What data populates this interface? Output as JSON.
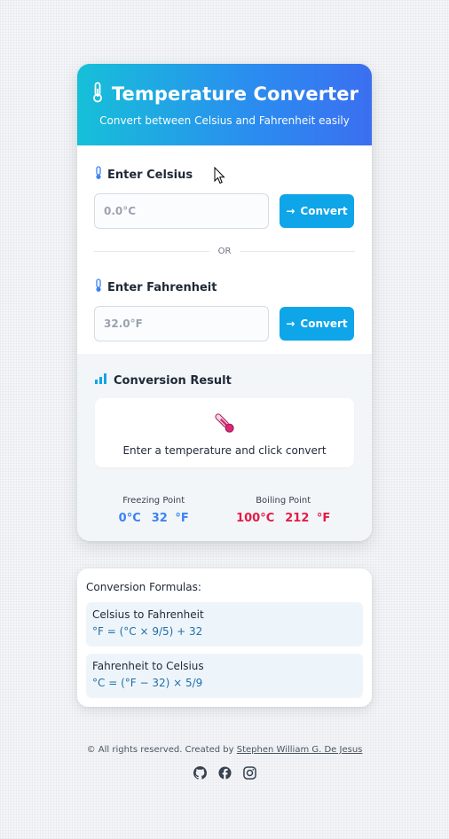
{
  "header": {
    "title": "Temperature Converter",
    "subtitle": "Convert between Celsius and Fahrenheit easily"
  },
  "celsius": {
    "label": "Enter Celsius",
    "placeholder": "0.0°C",
    "button_label": "Convert",
    "button_arrow": "→"
  },
  "divider": {
    "text": "OR"
  },
  "fahrenheit": {
    "label": "Enter Fahrenheit",
    "placeholder": "32.0°F",
    "button_label": "Convert",
    "button_arrow": "→"
  },
  "result": {
    "title": "Conversion Result",
    "message": "Enter a temperature and click convert"
  },
  "reference_points": [
    {
      "label": "Freezing Point",
      "celsius": "0°C",
      "fahrenheit": "32 °F"
    },
    {
      "label": "Boiling Point",
      "celsius": "100°C",
      "fahrenheit": "212 °F"
    }
  ],
  "formulas": {
    "title": "Conversion Formulas:",
    "items": [
      {
        "name": "Celsius to Fahrenheit",
        "equation": "°F = (°C × 9/5) + 32"
      },
      {
        "name": "Fahrenheit to Celsius",
        "equation": "°C = (°F − 32) × 5/9"
      }
    ]
  },
  "footer": {
    "text": "© All rights reserved. Created by",
    "author": "Stephen William G. De Jesus",
    "social": [
      "github-icon",
      "facebook-icon",
      "instagram-icon"
    ]
  },
  "colors": {
    "header_gradient_start": "#16c0d8",
    "header_gradient_end": "#3b6ff0",
    "button": "#0ea5e9",
    "cold": "#3b82f6",
    "hot": "#e11d48"
  }
}
